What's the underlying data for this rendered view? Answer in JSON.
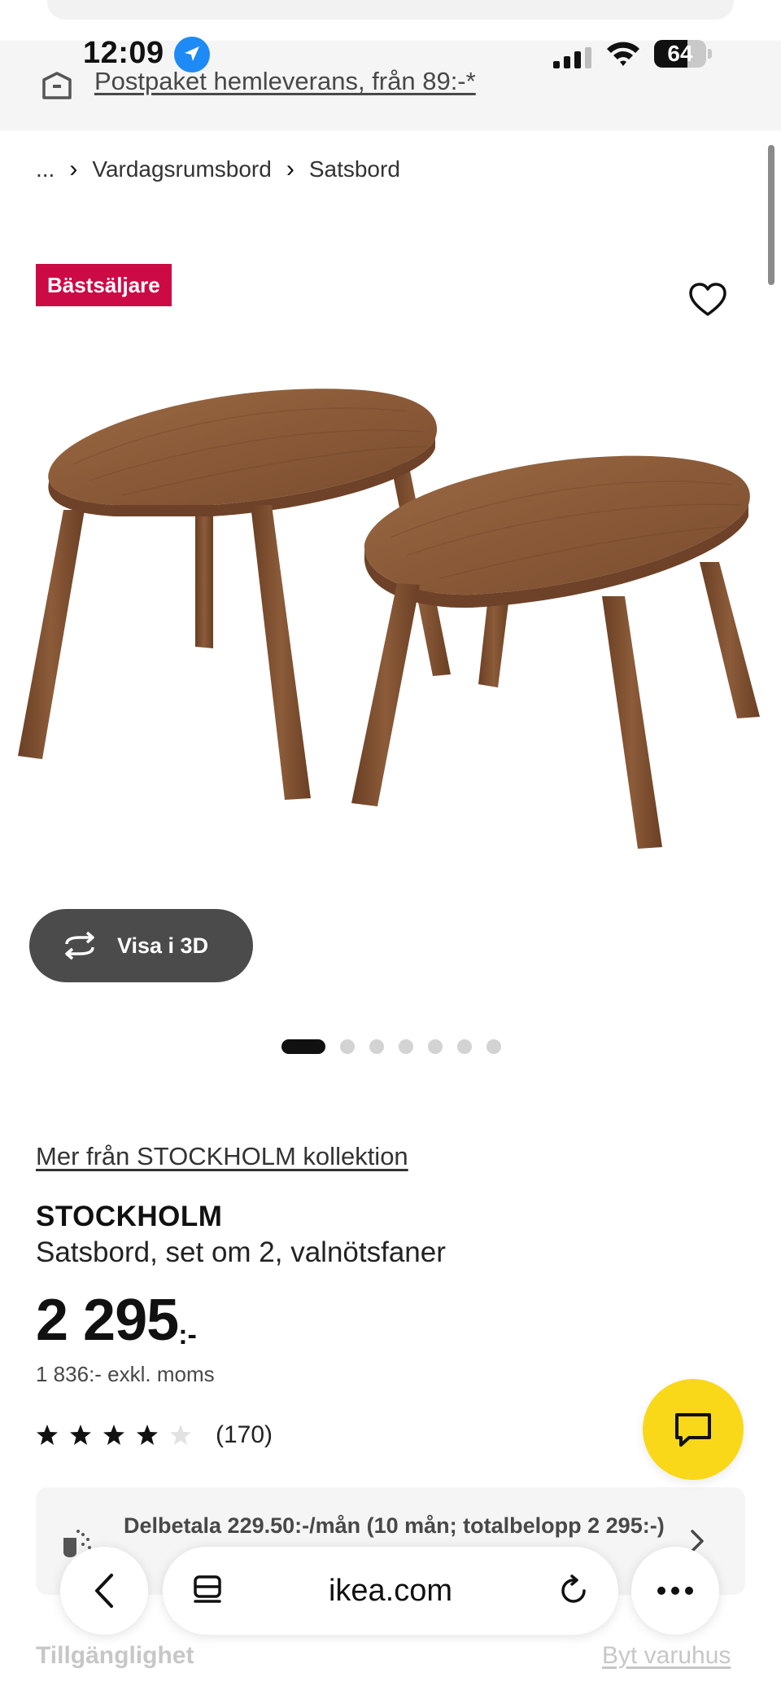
{
  "status_bar": {
    "time": "12:09",
    "battery_percent": "64",
    "battery_level": 0.64,
    "icons": [
      "location-arrow-icon",
      "cellular-signal-icon",
      "wifi-icon",
      "battery-icon"
    ]
  },
  "promo": {
    "icon": "delivery-box-icon",
    "text": "Postpaket hemleverans, från 89:-*"
  },
  "breadcrumb": {
    "ellipsis": "...",
    "items": [
      "Vardagsrumsbord",
      "Satsbord"
    ],
    "separator": "›"
  },
  "product": {
    "badge": "Bästsäljare",
    "favorite_icon": "heart-icon",
    "view_3d_label": "Visa i 3D",
    "image_count": 7,
    "active_image": 1,
    "collection_link": "Mer från STOCKHOLM kollektion",
    "name": "STOCKHOLM",
    "description": "Satsbord, set om 2, valnötsfaner",
    "price": "2 295",
    "price_suffix": ":-",
    "price_ex_vat": "1 836:- exkl. moms",
    "rating": {
      "stars": 4,
      "max": 5,
      "count": "(170)"
    }
  },
  "payment": {
    "text": "Delbetala 229.50:-/mån (10 mån; totalbelopp 2 295:-)"
  },
  "availability": {
    "label": "Tillgänglighet",
    "change_store": "Byt varuhus"
  },
  "browser": {
    "url": "ikea.com",
    "buttons": [
      "back-icon",
      "tabs-icon",
      "reload-icon",
      "more-icon"
    ]
  },
  "colors": {
    "badge": "#cc0a45",
    "chat_button": "#f9d819",
    "view_3d_button": "#4b4b4b",
    "location_icon": "#1e8af5"
  }
}
